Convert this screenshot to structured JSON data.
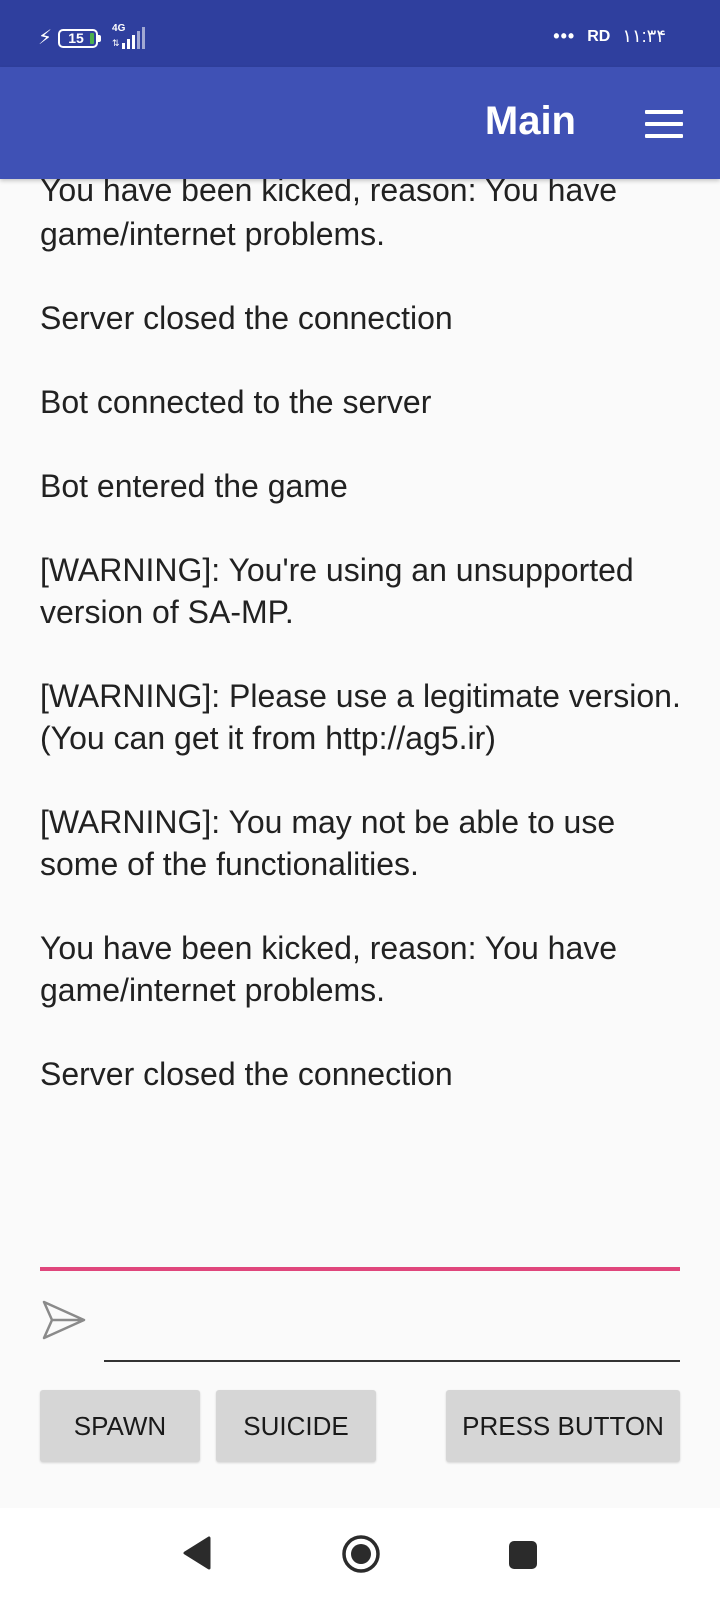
{
  "status_bar": {
    "battery": "15",
    "network": "4G",
    "dots": "•••",
    "carrier": "RD",
    "time": "۱۱:۳۴"
  },
  "app_bar": {
    "title": "Main",
    "menu_icon": "hamburger-menu-icon"
  },
  "log": {
    "partial_top_line": "You have been kicked, reason: You have",
    "entries": [
      "game/internet problems.",
      "Server closed the connection",
      "Bot connected to the server",
      "Bot entered the game",
      "[WARNING]: You're using an unsupported version of SA-MP.",
      "[WARNING]: Please use a legitimate version. (You can get it from http://ag5.ir)",
      "[WARNING]: You may not be able to use some of the functionalities.",
      "You have been kicked, reason: You have game/internet problems.",
      "Server closed the connection"
    ]
  },
  "input": {
    "value": "",
    "placeholder": "",
    "send_icon": "send-paper-plane-icon"
  },
  "buttons": {
    "spawn": "SPAWN",
    "suicide": "SUICIDE",
    "press": "PRESS BUTTON"
  },
  "nav_bar": {
    "back_icon": "back-triangle-icon",
    "home_icon": "home-circle-icon",
    "recent_icon": "recent-apps-square-icon"
  },
  "colors": {
    "status_bar": "#2f3f9e",
    "app_bar": "#3f51b5",
    "accent_underline": "#e0467c",
    "button_bg": "#d6d6d6"
  }
}
